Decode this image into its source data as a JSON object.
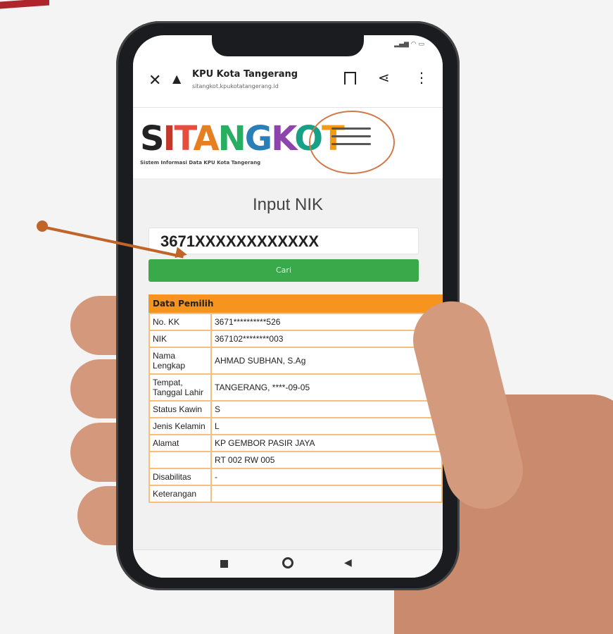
{
  "browser": {
    "title": "KPU Kota Tangerang",
    "url": "sitangkot.kpukotatangerang.id"
  },
  "logo": {
    "text": "SITANGKOT",
    "subtitle": "Sistem Informasi Data KPU Kota Tangerang"
  },
  "form": {
    "heading": "Input NIK",
    "nik_value": "3671XXXXXXXXXXXX",
    "search_label": "Cari"
  },
  "voter": {
    "section_title": "Data Pemilih",
    "rows": [
      {
        "key": "No. KK",
        "value": "3671**********526"
      },
      {
        "key": "NIK",
        "value": "367102********003"
      },
      {
        "key": "Nama Lengkap",
        "value": "AHMAD SUBHAN, S.Ag"
      },
      {
        "key": "Tempat, Tanggal Lahir",
        "value": "TANGERANG, ****-09-05"
      },
      {
        "key": "Status Kawin",
        "value": "S"
      },
      {
        "key": "Jenis Kelamin",
        "value": "L"
      },
      {
        "key": "Alamat",
        "value": "KP GEMBOR PASIR JAYA"
      },
      {
        "key": "",
        "value": "RT 002 RW 005"
      },
      {
        "key": "Disabilitas",
        "value": "-"
      },
      {
        "key": "Keterangan",
        "value": ""
      }
    ]
  },
  "icons": {
    "close": "close-icon",
    "warning": "warning-icon",
    "bookmark": "bookmark-icon",
    "share": "share-icon",
    "more": "more-vert-icon",
    "menu": "hamburger-menu-icon"
  },
  "colors": {
    "accent_orange": "#f7941d",
    "button_green": "#3aa94a",
    "annotation": "#c0642a"
  }
}
